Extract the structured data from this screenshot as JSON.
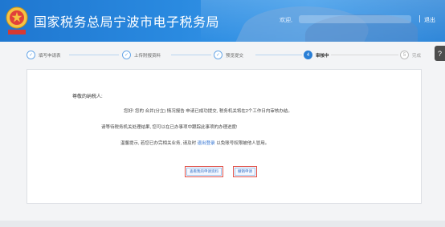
{
  "header": {
    "site_title": "国家税务总局宁波市电子税务局",
    "welcome_prefix": "欢迎,",
    "logout_label": "退出"
  },
  "steps": [
    {
      "label": "填写申请表",
      "number": "",
      "state": "done"
    },
    {
      "label": "上传附报资料",
      "number": "",
      "state": "done"
    },
    {
      "label": "预览提交",
      "number": "",
      "state": "done"
    },
    {
      "label": "审核中",
      "number": "4",
      "state": "active"
    },
    {
      "label": "完成",
      "number": "5",
      "state": "pending"
    }
  ],
  "help_icon_label": "?",
  "card": {
    "greeting": "尊敬的纳税人:",
    "line1": "您好! 您的 合并(分立) 情况报告 申请已成功提交, 税务机关将在2个工作日内审核办结。",
    "line2": "请等待税务机关处理结果, 您可以在已办事项中跟踪此事项的办理进度!",
    "line3_prefix": "温馨提示, 若您已办完相关业务, 请及时",
    "line3_link": "退出登录",
    "line3_suffix": "以免账号权限被他人冒用。",
    "view_button": "查看我的申请资料",
    "revoke_button": "撤销申请"
  },
  "colors": {
    "header_blue": "#1f77d0",
    "active_step": "#2a7fd6",
    "highlight_border": "#e0524b"
  }
}
